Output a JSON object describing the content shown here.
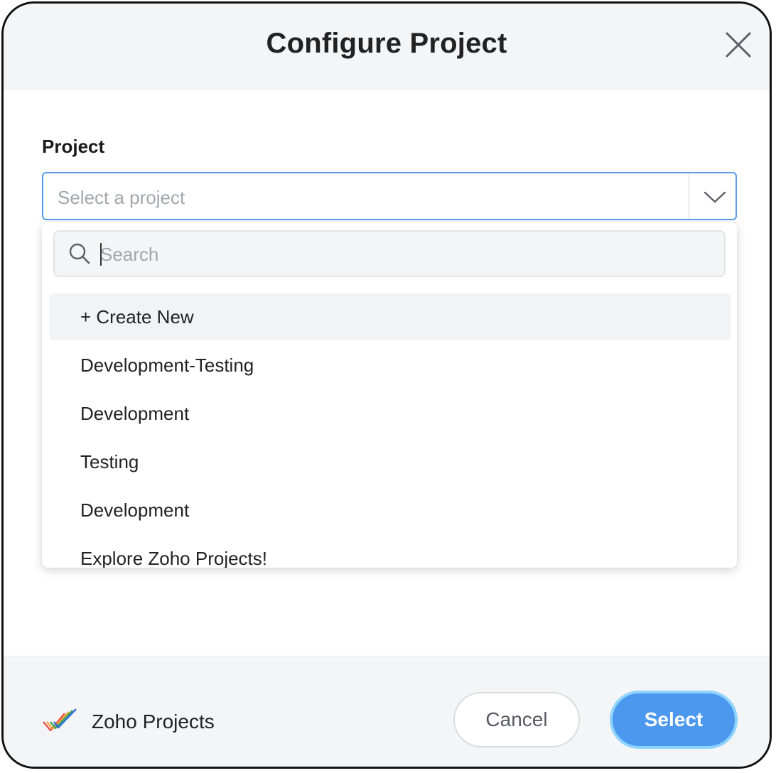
{
  "dialog": {
    "title": "Configure Project",
    "close_icon": "close-icon"
  },
  "project_field": {
    "label": "Project",
    "placeholder": "Select a project",
    "chevron_icon": "chevron-down-icon"
  },
  "dropdown": {
    "search_placeholder": "Search",
    "search_icon": "search-icon",
    "options": [
      {
        "label": "+ Create New",
        "highlighted": true
      },
      {
        "label": "Development-Testing",
        "highlighted": false
      },
      {
        "label": "Development",
        "highlighted": false
      },
      {
        "label": "Testing",
        "highlighted": false
      },
      {
        "label": "Development",
        "highlighted": false
      },
      {
        "label": "Explore Zoho Projects!",
        "highlighted": false
      }
    ]
  },
  "footer": {
    "brand_name": "Zoho Projects",
    "brand_icon": "zoho-projects-logo-icon",
    "cancel_label": "Cancel",
    "select_label": "Select"
  },
  "colors": {
    "accent": "#4c98ee",
    "focus_ring": "#8fd3ff",
    "input_border": "#5a9be8",
    "header_bg": "#f4f5f7"
  }
}
